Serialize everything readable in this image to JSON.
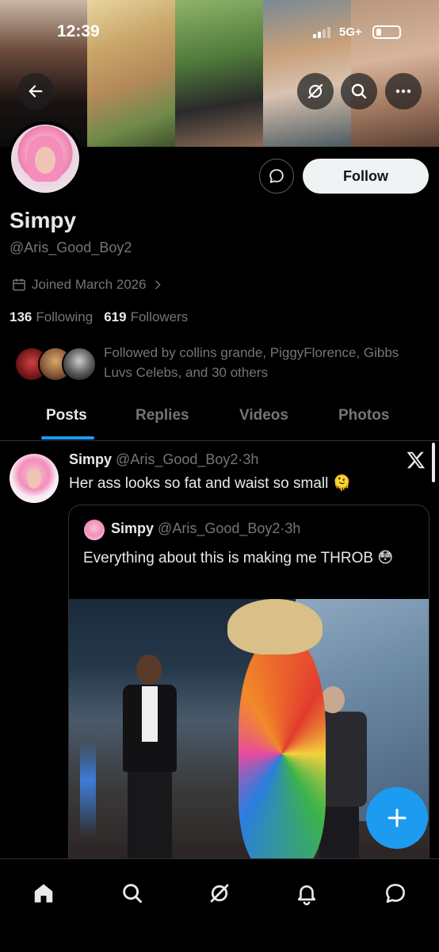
{
  "status_bar": {
    "time": "12:39",
    "network": "5G+"
  },
  "profile": {
    "display_name": "Simpy",
    "handle": "@Aris_Good_Boy2",
    "joined": "Joined March 2026",
    "following_count": "136",
    "following_label": "Following",
    "followers_count": "619",
    "followers_label": "Followers",
    "followed_by": "Followed by collins grande, PiggyFlorence, Gibbs Luvs Celebs, and 30 others",
    "follow_label": "Follow"
  },
  "tabs": [
    {
      "label": "Posts",
      "active": true
    },
    {
      "label": "Replies",
      "active": false
    },
    {
      "label": "Videos",
      "active": false
    },
    {
      "label": "Photos",
      "active": false
    }
  ],
  "post": {
    "author_name": "Simpy",
    "author_handle": "@Aris_Good_Boy2",
    "separator": "·",
    "time": "3h",
    "text": "Her ass looks so fat and waist so small 🫠",
    "quote": {
      "author_name": "Simpy",
      "author_handle": "@Aris_Good_Boy2",
      "separator": "·",
      "time": "3h",
      "text": "Everything about this is making me THROB 😳"
    }
  },
  "icons": {
    "back": "arrow-left-icon",
    "grok": "grok-icon",
    "search": "search-icon",
    "more": "more-horizontal-icon",
    "message": "message-icon",
    "calendar": "calendar-icon",
    "compose": "plus-icon",
    "nav": [
      "home-icon",
      "search-icon",
      "grok-icon",
      "bell-icon",
      "messages-icon"
    ]
  },
  "colors": {
    "accent": "#1d9bf0",
    "background": "#000000",
    "text_primary": "#e7e9ea",
    "text_secondary": "#71767b"
  }
}
